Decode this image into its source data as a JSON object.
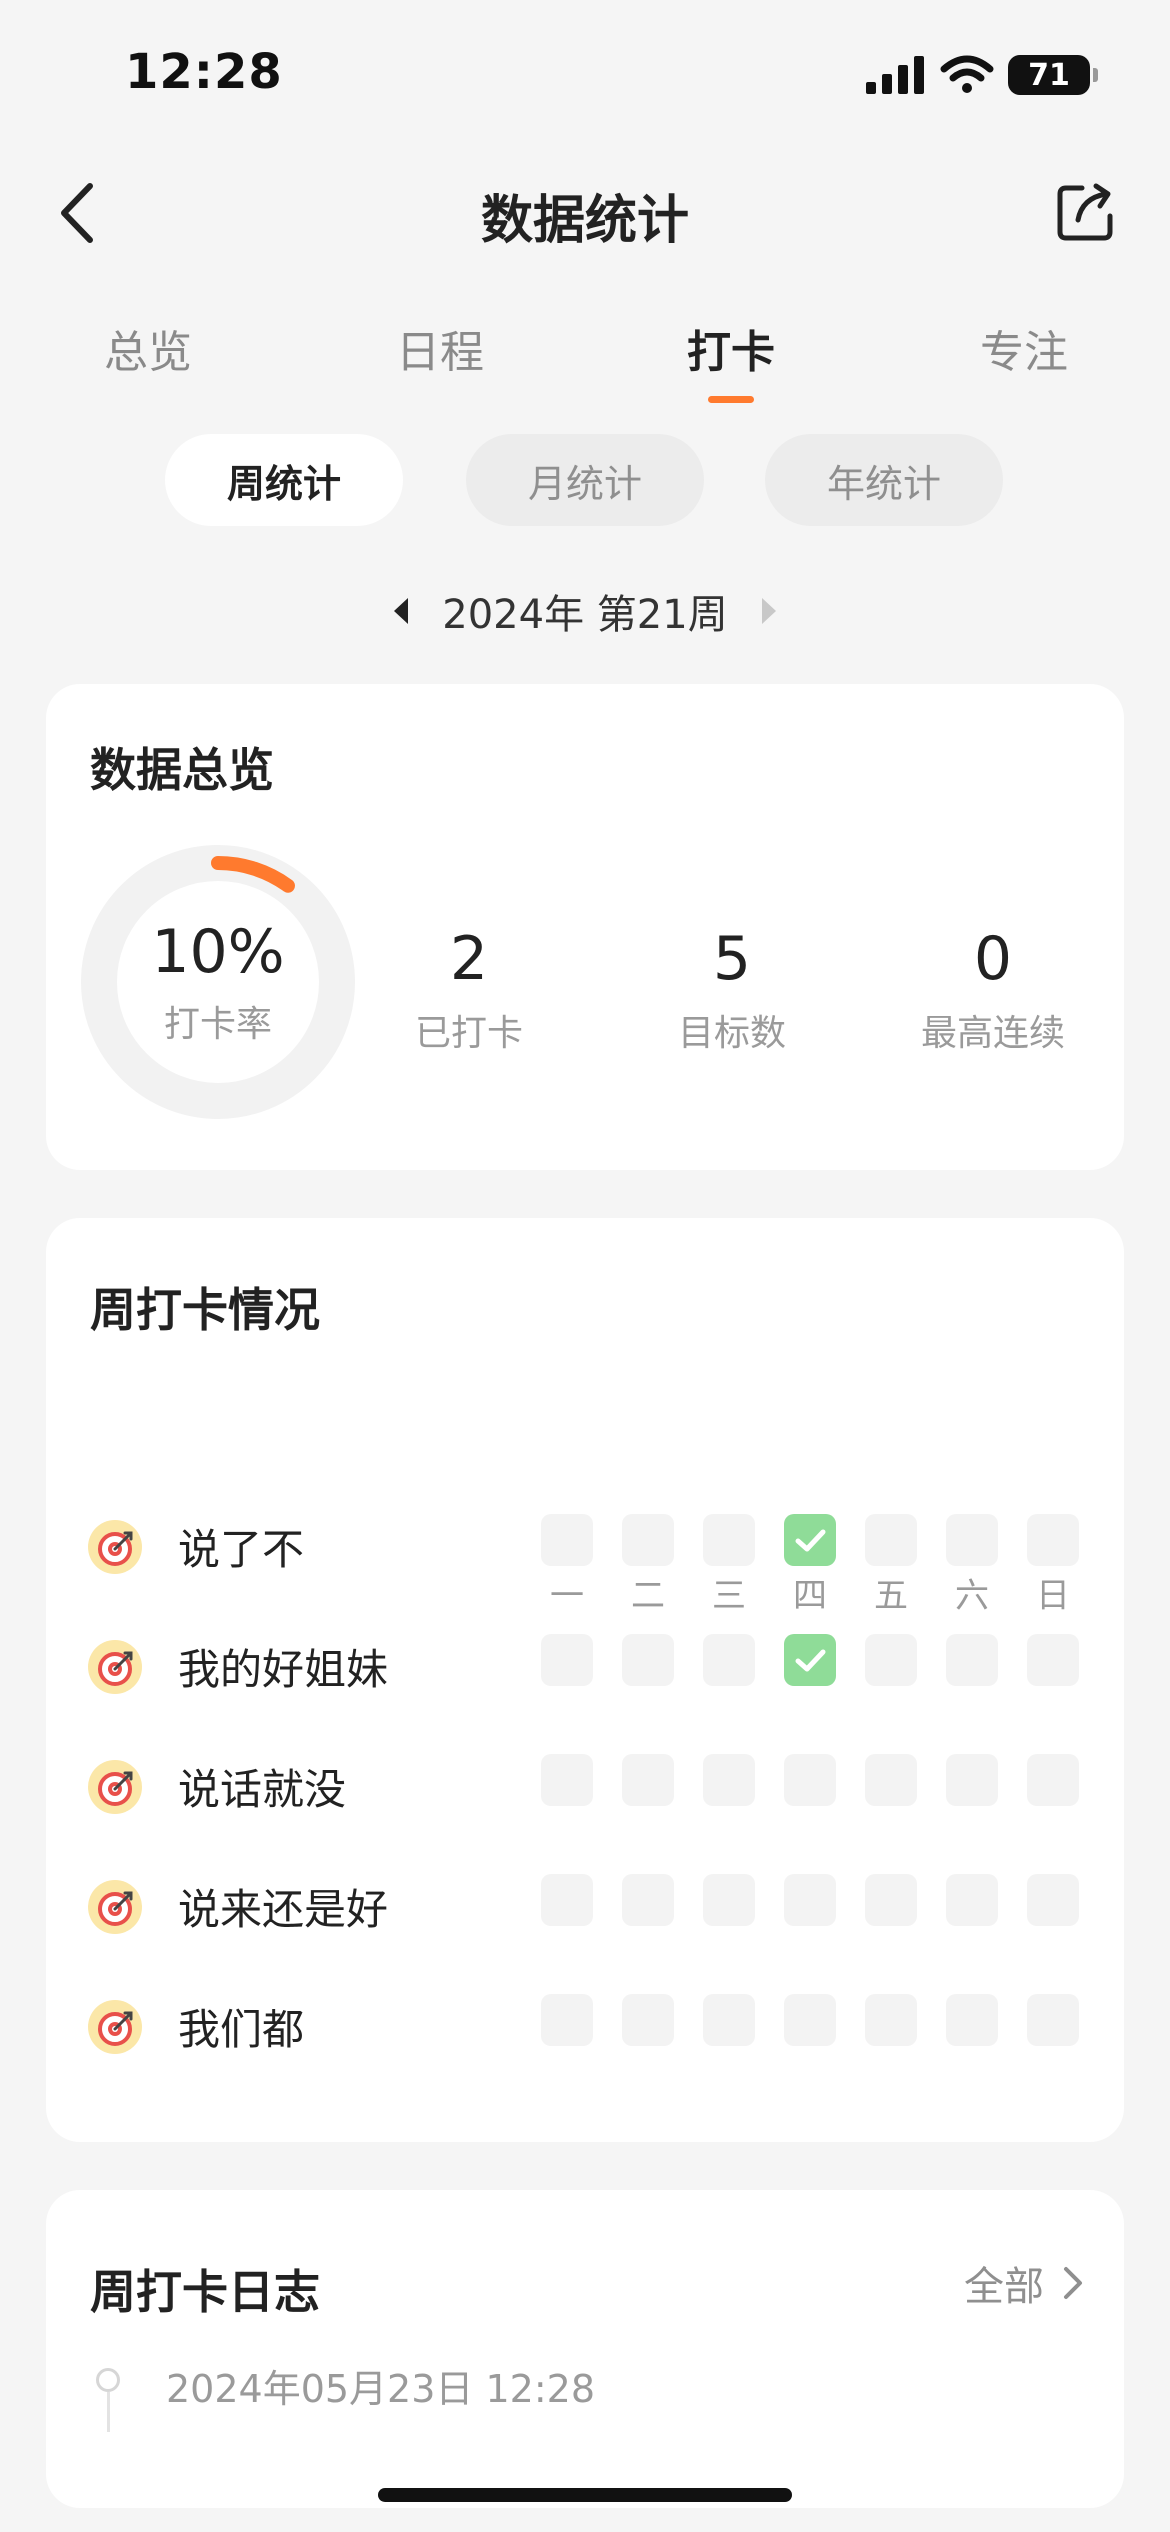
{
  "status_bar": {
    "time": "12:28",
    "battery": "71",
    "icons": [
      "signal-icon",
      "wifi-icon",
      "battery-icon"
    ]
  },
  "nav": {
    "title": "数据统计",
    "back_icon": "chevron-left-icon",
    "share_icon": "share-icon"
  },
  "tabs": [
    {
      "label": "总览",
      "active": false
    },
    {
      "label": "日程",
      "active": false
    },
    {
      "label": "打卡",
      "active": true
    },
    {
      "label": "专注",
      "active": false
    }
  ],
  "range_pills": [
    {
      "label": "周统计",
      "active": true
    },
    {
      "label": "月统计",
      "active": false
    },
    {
      "label": "年统计",
      "active": false
    }
  ],
  "week": {
    "label": "2024年 第21周"
  },
  "overview": {
    "title": "数据总览",
    "rate": {
      "value": "10%",
      "label": "打卡率",
      "fraction": 0.1
    },
    "stats": [
      {
        "value": "2",
        "label": "已打卡"
      },
      {
        "value": "5",
        "label": "目标数"
      },
      {
        "value": "0",
        "label": "最高连续"
      }
    ]
  },
  "weekly": {
    "title": "周打卡情况",
    "days": [
      "一",
      "二",
      "三",
      "四",
      "五",
      "六",
      "日"
    ],
    "habits": [
      {
        "name": "说了不",
        "done": [
          false,
          false,
          false,
          true,
          false,
          false,
          false
        ]
      },
      {
        "name": "我的好姐妹",
        "done": [
          false,
          false,
          false,
          true,
          false,
          false,
          false
        ]
      },
      {
        "name": "说话就没",
        "done": [
          false,
          false,
          false,
          false,
          false,
          false,
          false
        ]
      },
      {
        "name": "说来还是好",
        "done": [
          false,
          false,
          false,
          false,
          false,
          false,
          false
        ]
      },
      {
        "name": "我们都",
        "done": [
          false,
          false,
          false,
          false,
          false,
          false,
          false
        ]
      }
    ]
  },
  "log": {
    "title": "周打卡日志",
    "all_label": "全部",
    "entries": [
      {
        "time": "2024年05月23日 12:28"
      }
    ]
  },
  "colors": {
    "accent": "#ff7a2e",
    "check": "#8fdc98",
    "ring_track": "#f2f2f2",
    "background": "#f5f5f5"
  }
}
